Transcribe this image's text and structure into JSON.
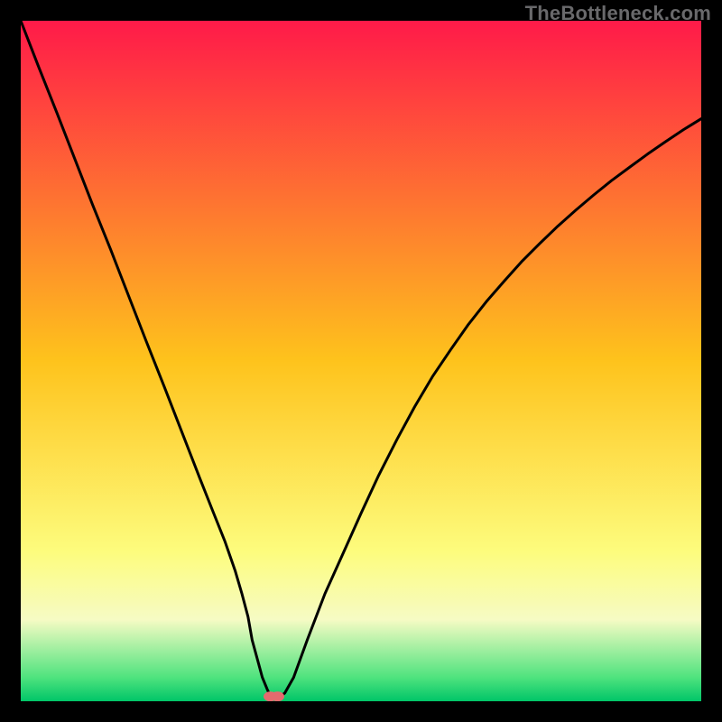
{
  "watermark": {
    "text": "TheBottleneck.com"
  },
  "chart_data": {
    "type": "line",
    "title": "",
    "xlabel": "",
    "ylabel": "",
    "xlim": [
      0,
      100
    ],
    "ylim": [
      0,
      100
    ],
    "grid": false,
    "legend": false,
    "background_gradient": {
      "stops": [
        {
          "offset": 0.0,
          "color": "#ff1a49"
        },
        {
          "offset": 0.5,
          "color": "#fec31c"
        },
        {
          "offset": 0.78,
          "color": "#fdfc7d"
        },
        {
          "offset": 0.88,
          "color": "#f6fbc4"
        },
        {
          "offset": 0.965,
          "color": "#4fe37e"
        },
        {
          "offset": 1.0,
          "color": "#00c568"
        }
      ]
    },
    "series": [
      {
        "name": "bottleneck-curve",
        "color": "#000000",
        "x": [
          0.0,
          2.6,
          5.3,
          7.9,
          10.5,
          13.2,
          15.8,
          18.4,
          21.1,
          23.7,
          26.3,
          28.2,
          30.0,
          31.5,
          32.5,
          33.4,
          34.0,
          34.9,
          35.5,
          36.2,
          36.6,
          37.0,
          37.8,
          38.8,
          40.1,
          42.1,
          44.7,
          47.4,
          50.0,
          52.6,
          55.3,
          57.9,
          60.5,
          63.2,
          65.8,
          68.4,
          71.1,
          73.7,
          76.3,
          78.9,
          81.6,
          84.2,
          86.8,
          89.5,
          92.1,
          94.7,
          97.4,
          100.0
        ],
        "y": [
          100.0,
          93.3,
          86.5,
          79.8,
          73.1,
          66.4,
          59.7,
          53.0,
          46.2,
          39.5,
          32.8,
          28.0,
          23.5,
          19.2,
          15.8,
          12.4,
          9.0,
          5.7,
          3.5,
          1.8,
          0.9,
          0.4,
          0.4,
          1.2,
          3.5,
          9.0,
          15.8,
          21.8,
          27.6,
          33.2,
          38.5,
          43.3,
          47.7,
          51.7,
          55.4,
          58.7,
          61.8,
          64.7,
          67.3,
          69.8,
          72.2,
          74.4,
          76.5,
          78.5,
          80.4,
          82.2,
          84.0,
          85.6
        ]
      }
    ],
    "marker": {
      "name": "bottleneck-marker",
      "color": "#e46a6e",
      "x": 37.2,
      "y": 0.7
    }
  }
}
